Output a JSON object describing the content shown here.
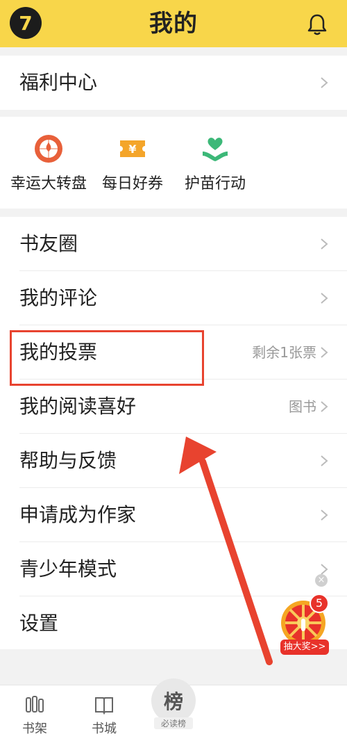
{
  "header": {
    "title": "我的",
    "logo_glyph": "7",
    "bell_icon": "bell-icon",
    "color": "#f8d64a"
  },
  "welfare": {
    "label": "福利中心"
  },
  "quick_actions": [
    {
      "label": "幸运大转盘",
      "icon": "wheel-icon",
      "color": "#e8603a"
    },
    {
      "label": "每日好券",
      "icon": "coupon-icon",
      "color": "#f4a52a"
    },
    {
      "label": "护苗行动",
      "icon": "heart-hands-icon",
      "color": "#3cb878"
    }
  ],
  "menu": [
    {
      "label": "书友圈",
      "extra": ""
    },
    {
      "label": "我的评论",
      "extra": ""
    },
    {
      "label": "我的投票",
      "extra": "剩余1张票"
    },
    {
      "label": "我的阅读喜好",
      "extra": "图书"
    },
    {
      "label": "帮助与反馈",
      "extra": ""
    },
    {
      "label": "申请成为作家",
      "extra": ""
    },
    {
      "label": "青少年模式",
      "extra": ""
    },
    {
      "label": "设置",
      "extra": ""
    }
  ],
  "lottery": {
    "badge": "5",
    "label": "抽大奖>>",
    "close": "×"
  },
  "bottom_nav": {
    "bookshelf": "书架",
    "bookstore": "书城",
    "rank_glyph": "榜",
    "rank_label": "必读榜"
  },
  "annotation_color": "#e8432f"
}
